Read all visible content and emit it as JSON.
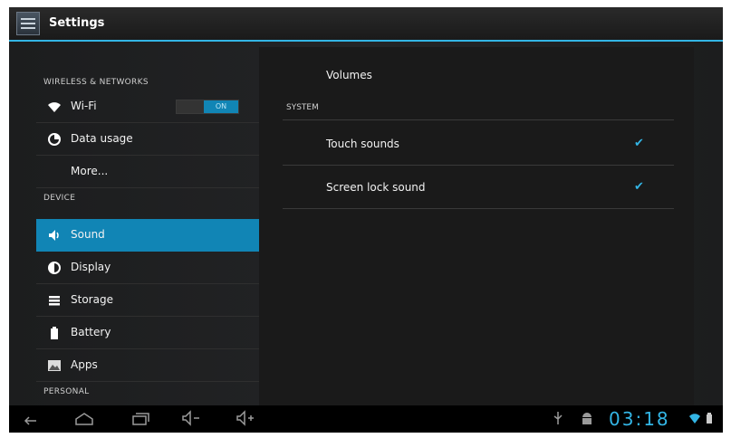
{
  "app": {
    "title": "Settings"
  },
  "sidebar": {
    "wireless_header": "WIRELESS & NETWORKS",
    "wifi": {
      "label": "Wi-Fi",
      "toggle": "ON"
    },
    "data_usage": "Data usage",
    "more": "More...",
    "device_header": "DEVICE",
    "sound": "Sound",
    "display": "Display",
    "storage": "Storage",
    "battery": "Battery",
    "apps": "Apps",
    "personal_header": "PERSONAL"
  },
  "detail": {
    "volumes": "Volumes",
    "system_header": "SYSTEM",
    "touch_sounds": {
      "label": "Touch sounds",
      "checked": true
    },
    "screen_lock_sound": {
      "label": "Screen lock sound",
      "checked": true
    }
  },
  "statusbar": {
    "time": "03:18"
  },
  "colors": {
    "accent": "#33b5e5",
    "selected": "#1185b5"
  }
}
